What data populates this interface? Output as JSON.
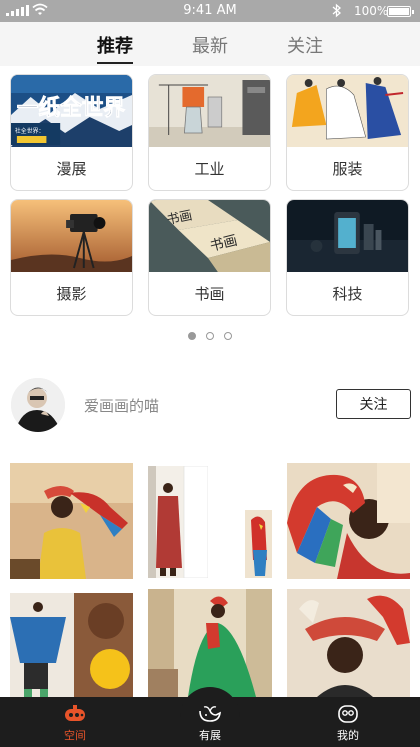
{
  "status_bar": {
    "time": "9:41 AM",
    "battery": "100%"
  },
  "tabs": [
    {
      "label": "推荐",
      "active": true
    },
    {
      "label": "最新",
      "active": false
    },
    {
      "label": "关注",
      "active": false
    }
  ],
  "categories": [
    {
      "label": "漫展"
    },
    {
      "label": "工业"
    },
    {
      "label": "服装"
    },
    {
      "label": "摄影"
    },
    {
      "label": "书画"
    },
    {
      "label": "科技"
    }
  ],
  "carousel": {
    "pages": 3,
    "current": 1
  },
  "featured_user": {
    "name": "爱画画的喵",
    "follow_label": "关注"
  },
  "bottom_nav": [
    {
      "label": "空间",
      "icon": "submarine-icon",
      "active": true
    },
    {
      "label": "有展",
      "icon": "whale-icon",
      "active": false
    },
    {
      "label": "我的",
      "icon": "profile-icon",
      "active": false
    }
  ],
  "colors": {
    "accent": "#e8542a",
    "nav_bg": "#1d1d1d",
    "status_bg": "#a9a9a9"
  },
  "comic_poster_text": {
    "headline": "一纸全世界",
    "sub": "社全世界："
  },
  "calligraphy_book_text": {
    "top": "书画",
    "bottom": "书画"
  }
}
